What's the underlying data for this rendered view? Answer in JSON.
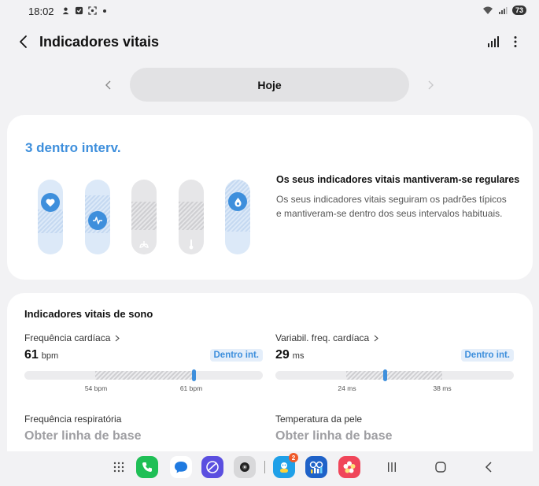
{
  "status_bar": {
    "time": "18:02",
    "battery": "73",
    "icons": [
      "notification-icon",
      "checkbox-icon",
      "screenshot-icon",
      "wifi-icon",
      "signal-icon"
    ]
  },
  "header": {
    "title": "Indicadores vitais",
    "icons": [
      "back-icon",
      "chart-bars-icon",
      "more-vert-icon"
    ]
  },
  "date_nav": {
    "label": "Hoje"
  },
  "summary": {
    "heading": "3 dentro interv.",
    "title": "Os seus indicadores vitais mantiveram-se regulares",
    "description": "Os seus indicadores vitais seguiram os padrões típicos e mantiveram-se dentro dos seus intervalos habituais.",
    "accent_color": "#3e8fdc",
    "indicators": [
      {
        "name": "heart-icon",
        "in_range": true
      },
      {
        "name": "heart-rate-icon",
        "in_range": true
      },
      {
        "name": "breathing-icon",
        "in_range": false
      },
      {
        "name": "thermometer-icon",
        "in_range": false
      },
      {
        "name": "drop-icon",
        "in_range": true
      }
    ]
  },
  "sleep": {
    "title": "Indicadores vitais de sono",
    "metrics": [
      {
        "label": "Frequência cardíaca",
        "value": "61",
        "unit": "bpm",
        "badge": "Dentro int.",
        "range_low": "54 bpm",
        "range_high": "61 bpm"
      },
      {
        "label": "Variabil. freq. cardíaca",
        "value": "29",
        "unit": "ms",
        "badge": "Dentro int.",
        "range_low": "24 ms",
        "range_high": "38 ms"
      },
      {
        "label": "Frequência respiratória",
        "baseline": "Obter linha de base"
      },
      {
        "label": "Temperatura da pele",
        "baseline": "Obter linha de base"
      }
    ]
  },
  "dock": {
    "apps": [
      "apps-grid-icon",
      "phone-icon",
      "messages-icon",
      "internet-icon",
      "camera-icon",
      "bixby-icon",
      "samsung-health-icon",
      "gallery-icon"
    ],
    "badge": "2"
  }
}
